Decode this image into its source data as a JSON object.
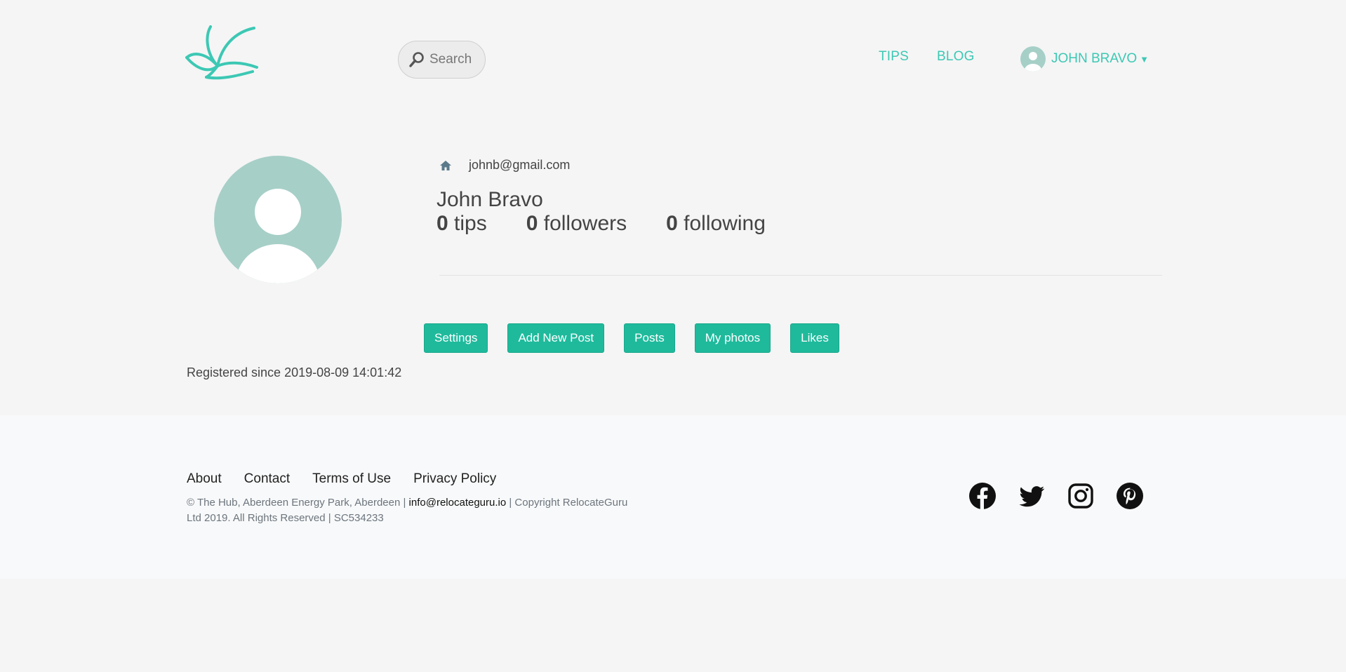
{
  "header": {
    "search_placeholder": "Search",
    "nav": {
      "tips": "TIPS",
      "blog": "BLOG"
    },
    "user_name": "JOHN BRAVO"
  },
  "profile": {
    "email": "johnb@gmail.com",
    "name": "John Bravo",
    "stats": {
      "tips_count": "0",
      "tips_label": "tips",
      "followers_count": "0",
      "followers_label": "followers",
      "following_count": "0",
      "following_label": "following"
    },
    "buttons": {
      "settings": "Settings",
      "add_post": "Add New Post",
      "posts": "Posts",
      "photos": "My photos",
      "likes": "Likes"
    },
    "registered": "Registered since 2019-08-09 14:01:42"
  },
  "footer": {
    "links": {
      "about": "About",
      "contact": "Contact",
      "terms": "Terms of Use",
      "privacy": "Privacy Policy"
    },
    "address": "© The Hub, Aberdeen Energy Park, Aberdeen |",
    "email": "info@relocateguru.io",
    "copyright": "| Copyright RelocateGuru Ltd 2019. All Rights Reserved | SC534233"
  },
  "colors": {
    "accent": "#3cc8b4",
    "button": "#1fba9c",
    "avatar": "#a6cfc7",
    "background": "#f5f5f5",
    "footer_bg": "#f8f9fa"
  },
  "icons": {
    "logo": "swallow-bird-logo",
    "search": "magnifier-icon",
    "home": "home-icon",
    "caret": "caret-down-icon",
    "socials": [
      "facebook-icon",
      "twitter-icon",
      "instagram-icon",
      "pinterest-icon"
    ]
  }
}
